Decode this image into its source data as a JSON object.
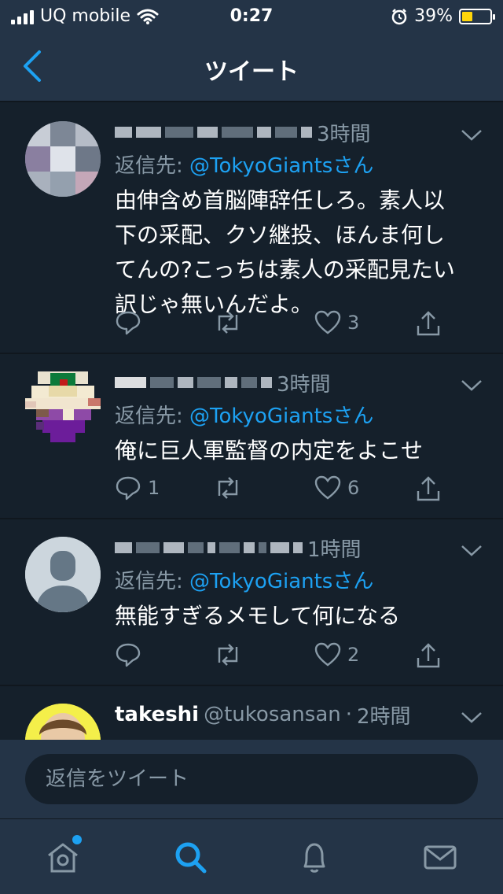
{
  "status_bar": {
    "carrier": "UQ mobile",
    "time": "0:27",
    "battery": "39%",
    "battery_level": 0.39,
    "battery_color": "#ffd60a"
  },
  "nav": {
    "title": "ツイート",
    "back_icon": "chevron-left-icon"
  },
  "colors": {
    "background": "#15202b",
    "bar": "#243447",
    "accent": "#1da1f2",
    "secondary_text": "#8899a6"
  },
  "tweets": [
    {
      "time": "3時間",
      "reply_prefix": "返信先: ",
      "reply_handle": "@TokyoGiantsさん",
      "text": "由伸含め首脳陣辞任しろ。素人以下の采配、クソ継投、ほんま何してんの?こっちは素人の采配見たい訳じゃ無いんだよ。",
      "reply_count": "",
      "like_count": "3"
    },
    {
      "time": "3時間",
      "reply_prefix": "返信先: ",
      "reply_handle": "@TokyoGiantsさん",
      "text": "俺に巨人軍監督の内定をよこせ",
      "reply_count": "1",
      "like_count": "6"
    },
    {
      "time": "1時間",
      "reply_prefix": "返信先: ",
      "reply_handle": "@TokyoGiantsさん",
      "text": "無能すぎるメモして何になる",
      "reply_count": "",
      "like_count": "2"
    },
    {
      "name": "takeshi",
      "handle": "@tukosansan",
      "separator": "·",
      "time": "2時間"
    }
  ],
  "reply_bar": {
    "placeholder": "返信をツイート"
  },
  "tab_bar": {
    "items": [
      "home-icon",
      "search-icon",
      "notifications-icon",
      "messages-icon"
    ]
  }
}
